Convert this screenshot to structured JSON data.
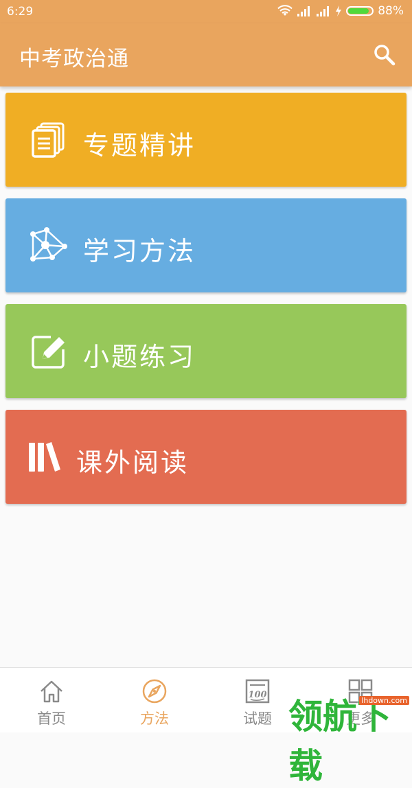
{
  "status_bar": {
    "time": "6:29",
    "battery": "88%",
    "battery_level": 0.88
  },
  "app_bar": {
    "title": "中考政治通"
  },
  "cards": [
    {
      "label": "专题精讲",
      "color": "#f0ae24"
    },
    {
      "label": "学习方法",
      "color": "#66ade1"
    },
    {
      "label": "小题练习",
      "color": "#97c85a"
    },
    {
      "label": "课外阅读",
      "color": "#e36c51"
    }
  ],
  "bottom_nav": {
    "items": [
      {
        "label": "首页",
        "icon": "home-icon"
      },
      {
        "label": "方法",
        "icon": "compass-icon",
        "active": true
      },
      {
        "label": "试题",
        "icon": "exam-100-icon"
      },
      {
        "label": "更多",
        "icon": "grid-icon"
      }
    ],
    "active_color": "#e9a55e"
  },
  "watermark": {
    "text": "领航下载",
    "badge": "lhdown.com"
  }
}
